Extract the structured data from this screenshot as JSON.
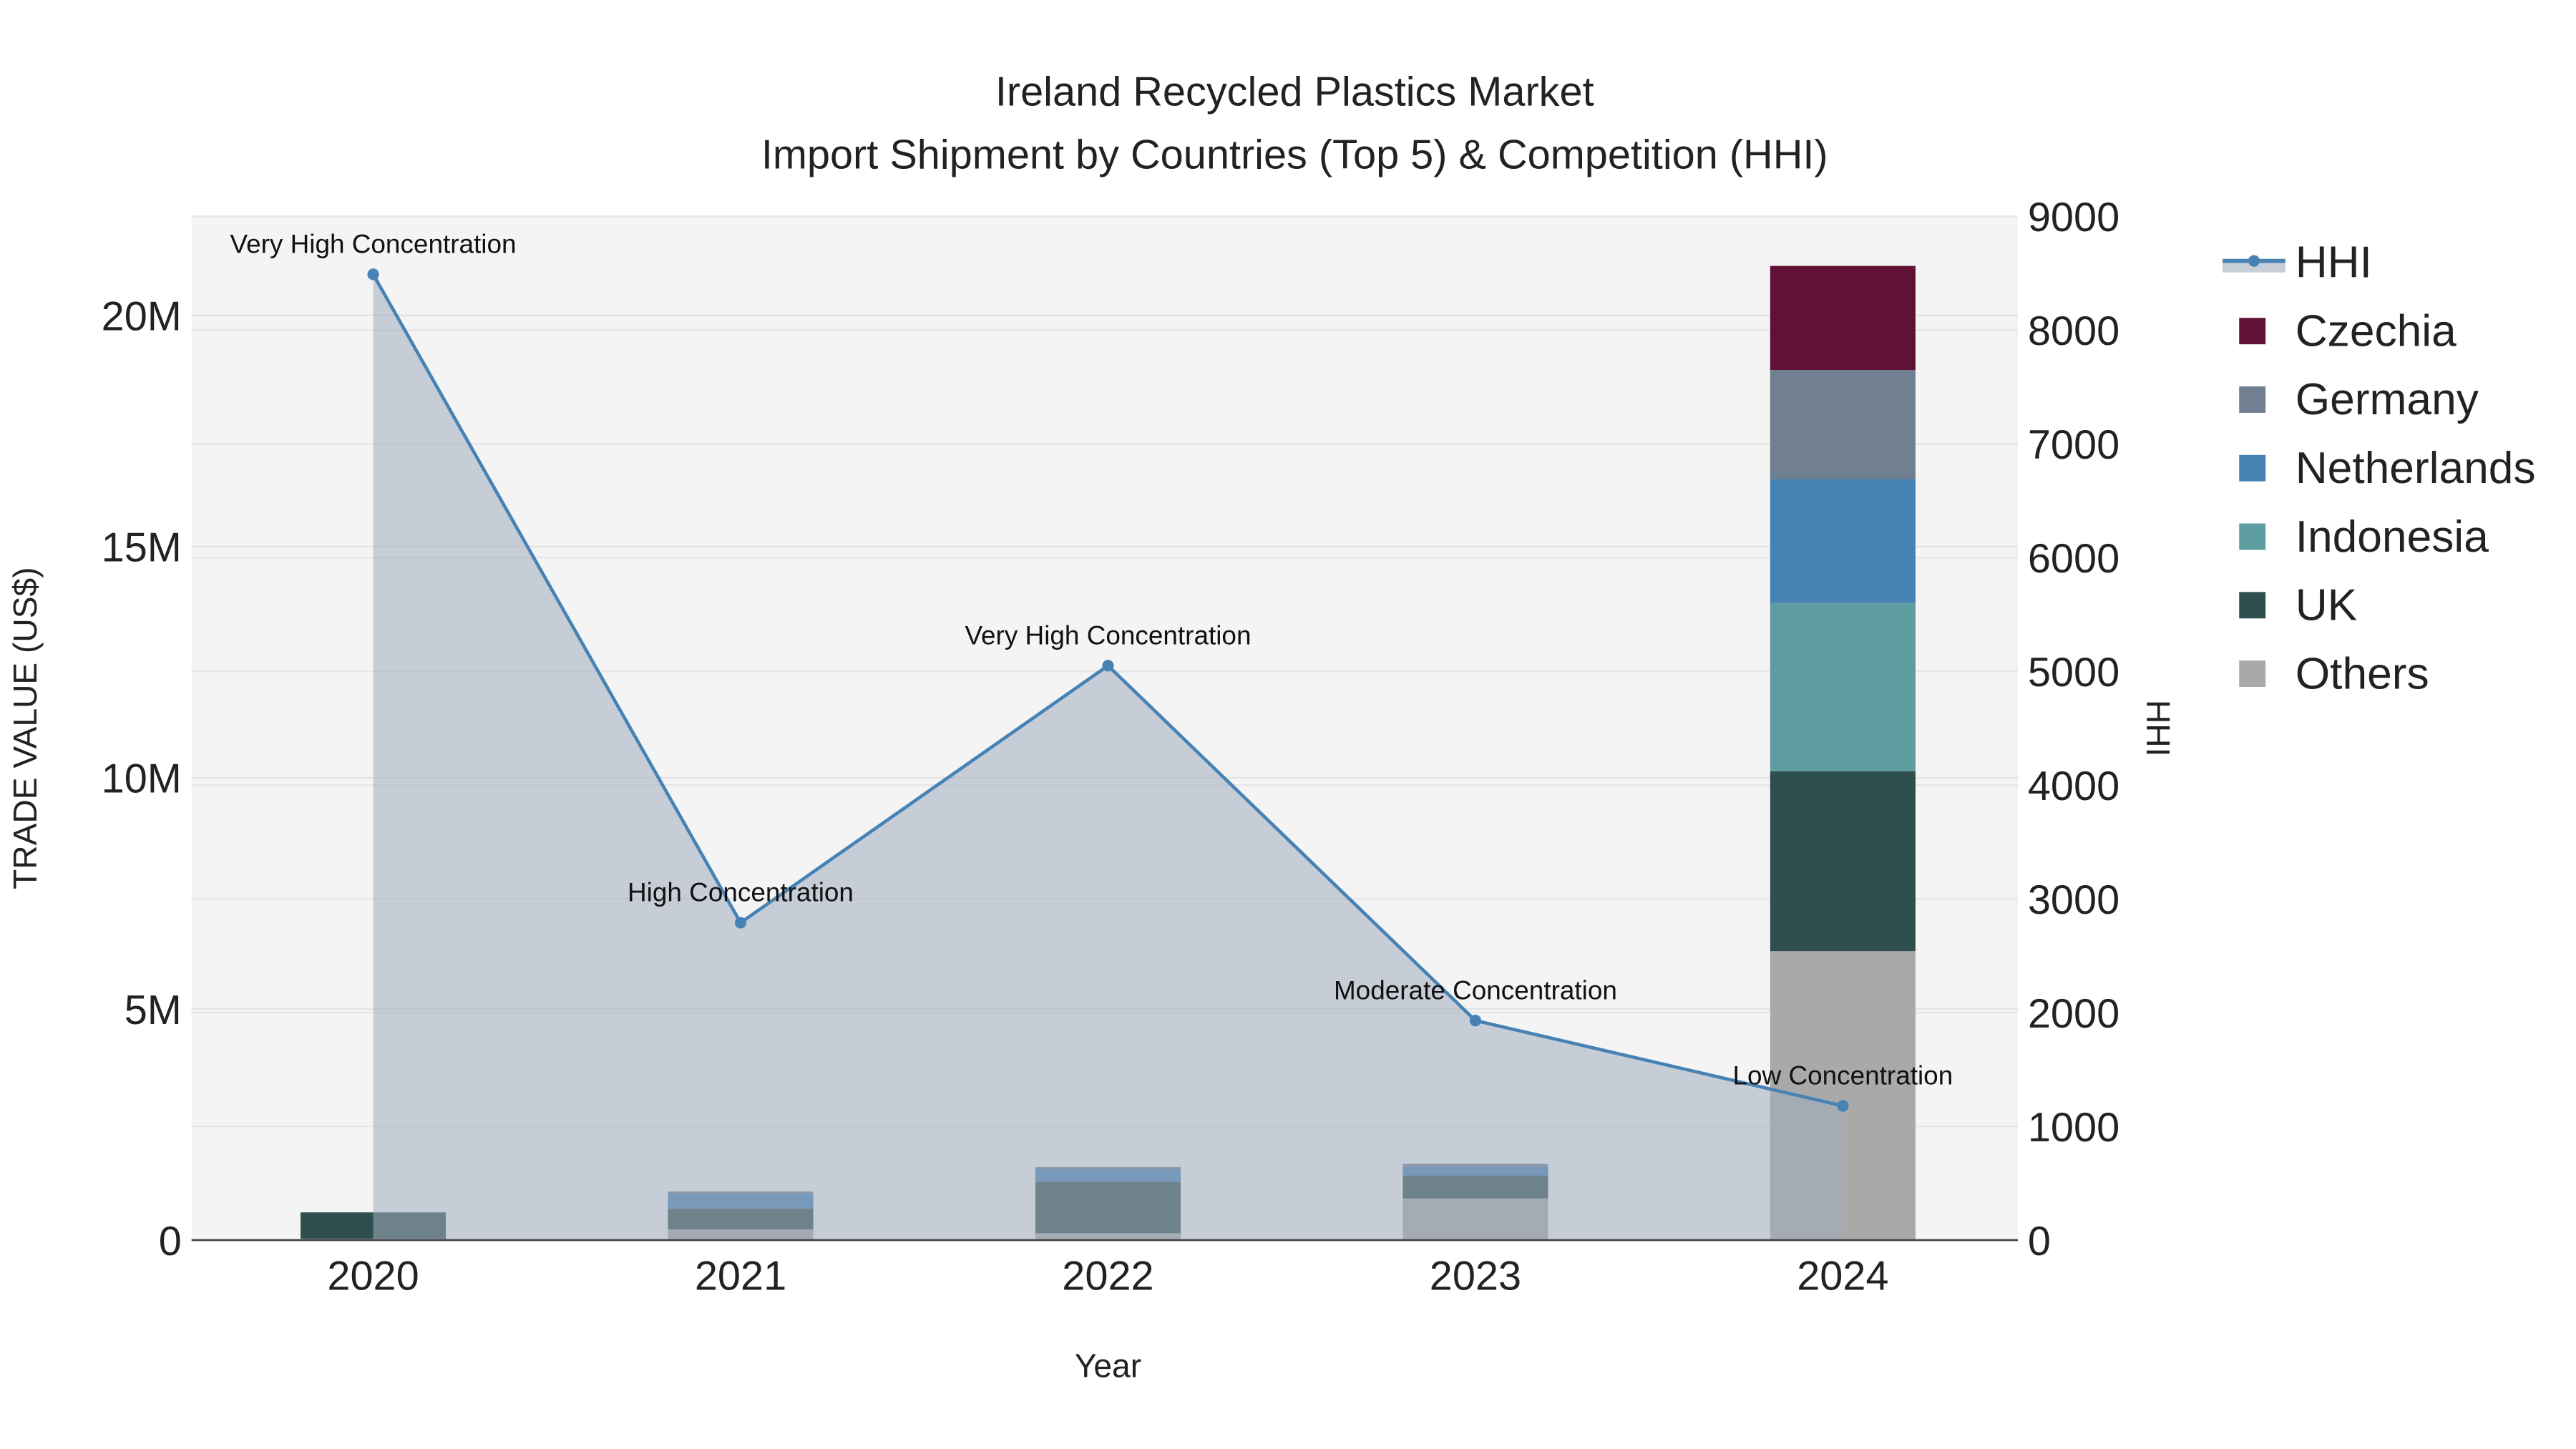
{
  "chart_data": {
    "type": "bar",
    "title": "Ireland Recycled Plastics Market",
    "subtitle": "Import Shipment by Countries (Top 5) & Competition (HHI)",
    "xlabel": "Year",
    "ylabel": "TRADE VALUE (US$)",
    "y2label": "HHI",
    "categories": [
      "2020",
      "2021",
      "2022",
      "2023",
      "2024"
    ],
    "ylim": [
      0,
      22142857
    ],
    "y_ticks": [
      0,
      5000000,
      10000000,
      15000000,
      20000000
    ],
    "y_tick_labels": [
      "0",
      "5M",
      "10M",
      "15M",
      "20M"
    ],
    "y2lim": [
      0,
      9000
    ],
    "y2_ticks": [
      0,
      1000,
      2000,
      3000,
      4000,
      5000,
      6000,
      7000,
      8000,
      9000
    ],
    "y2_tick_labels": [
      "0",
      "1000",
      "2000",
      "3000",
      "4000",
      "5000",
      "6000",
      "7000",
      "8000",
      "9000"
    ],
    "stacked": true,
    "series": [
      {
        "name": "Others",
        "color": "#a9a9a9",
        "values": [
          30000,
          230000,
          150000,
          900000,
          6250000
        ]
      },
      {
        "name": "UK",
        "color": "#2f4f4f",
        "values": [
          570000,
          450000,
          1110000,
          500000,
          3890000
        ]
      },
      {
        "name": "Indonesia",
        "color": "#5f9ea0",
        "values": [
          0,
          0,
          0,
          0,
          3640000
        ]
      },
      {
        "name": "Netherlands",
        "color": "#4682b4",
        "values": [
          0,
          330000,
          280000,
          190000,
          2680000
        ]
      },
      {
        "name": "Germany",
        "color": "#708090",
        "values": [
          0,
          40000,
          40000,
          60000,
          2360000
        ]
      },
      {
        "name": "Czechia",
        "color": "#5f1235",
        "values": [
          0,
          0,
          0,
          0,
          2250000
        ]
      }
    ],
    "hhi": {
      "name": "HHI",
      "color": "#4682b4",
      "values": [
        8490,
        2790,
        5050,
        1930,
        1180
      ],
      "annotations": [
        "Very High Concentration",
        "High Concentration",
        "Very High Concentration",
        "Moderate Concentration",
        "Low Concentration"
      ]
    },
    "legend": {
      "placement": "right",
      "entries": [
        "HHI",
        "Czechia",
        "Germany",
        "Netherlands",
        "Indonesia",
        "UK",
        "Others"
      ]
    },
    "grid": true
  }
}
